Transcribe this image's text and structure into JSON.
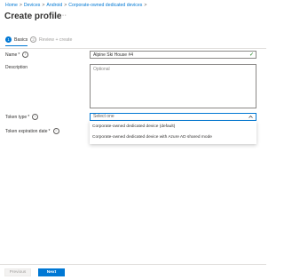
{
  "breadcrumb": {
    "items": [
      "Home",
      "Devices",
      "Android",
      "Corporate-owned dedicated devices"
    ]
  },
  "page": {
    "title": "Create profile",
    "more": "···"
  },
  "steps": [
    {
      "number": "1",
      "label": "Basics",
      "state": "active"
    },
    {
      "number": "2",
      "label": "Review + create",
      "state": "inactive"
    }
  ],
  "form": {
    "name": {
      "label": "Name",
      "required": "*",
      "value": "Alpine Ski House #4",
      "valid_icon": "checkmark-icon"
    },
    "description": {
      "label": "Description",
      "placeholder": "Optional"
    },
    "token_type": {
      "label": "Token type",
      "required": "*",
      "placeholder": "Select one",
      "options": [
        "Corporate-owned dedicated device (default)",
        "Corporate-owned dedicated device with Azure AD shared mode"
      ]
    },
    "token_expiration": {
      "label": "Token expiration date",
      "required": "*"
    }
  },
  "footer": {
    "previous_label": "Previous",
    "next_label": "Next"
  },
  "colors": {
    "accent": "#0078d4",
    "success": "#107c10",
    "text": "#323130"
  }
}
